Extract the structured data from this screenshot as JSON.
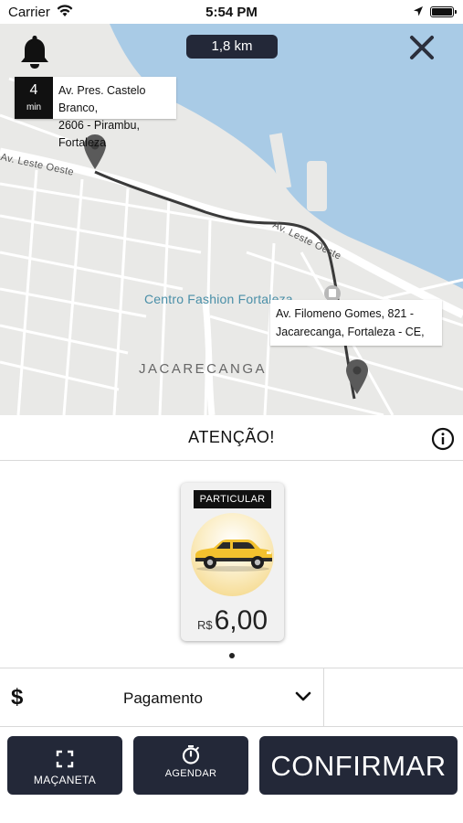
{
  "status_bar": {
    "carrier": "Carrier",
    "time": "5:54 PM",
    "battery_level": 1.0
  },
  "map": {
    "distance": "1,8 km",
    "origin": {
      "eta_value": "4",
      "eta_unit": "min",
      "address_line1": "Av. Pres. Castelo Branco,",
      "address_line2": "2606 - Pirambu, Fortaleza"
    },
    "destination": {
      "address_line1": "Av. Filomeno Gomes, 821 -",
      "address_line2": "Jacarecanga, Fortaleza - CE,"
    },
    "labels": {
      "street_west": "Av. Leste Oeste",
      "street_east": "Av. Leste Oeste",
      "poi": "Centro Fashion Fortaleza",
      "neighborhood": "JACARECANGA"
    },
    "colors": {
      "water": "#a9cbe6",
      "land": "#e9e9e7",
      "route": "#3a3a3a"
    }
  },
  "attention": {
    "title": "ATENÇÃO!"
  },
  "vehicle": {
    "category": "PARTICULAR",
    "currency": "R$",
    "price": "6,00",
    "car_color": "#f2c12e"
  },
  "payment": {
    "icon_symbol": "$",
    "label": "Pagamento"
  },
  "actions": {
    "macaneta_label": "MAÇANETA",
    "agendar_label": "AGENDAR",
    "confirmar_label": "CONFIRMAR"
  },
  "theme": {
    "dark_button": "#232838",
    "accent_text": "#ffffff"
  }
}
